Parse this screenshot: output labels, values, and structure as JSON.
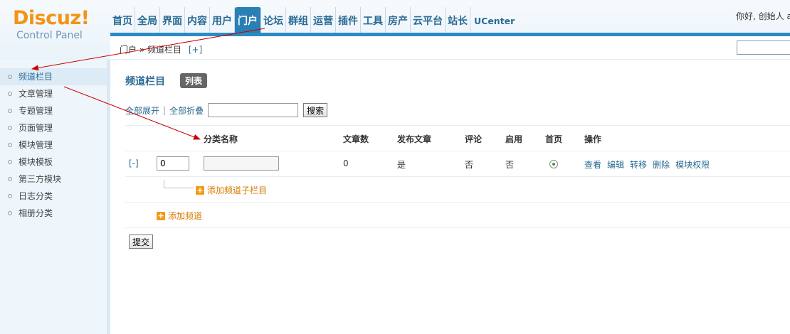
{
  "logo": {
    "word": "Discuz!",
    "subtitle": "Control Panel"
  },
  "topnav": [
    {
      "label": "首页"
    },
    {
      "label": "全局"
    },
    {
      "label": "界面"
    },
    {
      "label": "内容"
    },
    {
      "label": "用户"
    },
    {
      "label": "门户",
      "active": true
    },
    {
      "label": "论坛"
    },
    {
      "label": "群组"
    },
    {
      "label": "运营"
    },
    {
      "label": "插件"
    },
    {
      "label": "工具"
    },
    {
      "label": "房产"
    },
    {
      "label": "云平台"
    },
    {
      "label": "站长"
    },
    {
      "label": "UCenter"
    }
  ],
  "greeting": "你好, 创始人 a",
  "breadcrumb": {
    "path": "门户 » 频道栏目",
    "add": "[+]"
  },
  "sidebar": {
    "items": [
      {
        "label": "频道栏目",
        "active": true
      },
      {
        "label": "文章管理"
      },
      {
        "label": "专题管理"
      },
      {
        "label": "页面管理"
      },
      {
        "label": "模块管理"
      },
      {
        "label": "模块模板"
      },
      {
        "label": "第三方模块"
      },
      {
        "label": "日志分类"
      },
      {
        "label": "相册分类"
      }
    ]
  },
  "main": {
    "title": "频道栏目",
    "tab": "列表",
    "expand_all": "全部展开",
    "separator": "|",
    "collapse_all": "全部折叠",
    "search_button": "搜索",
    "table": {
      "headers": {
        "name": "分类名称",
        "articles": "文章数",
        "publish": "发布文章",
        "comment": "评论",
        "enabled": "启用",
        "homepage": "首页",
        "actions": "操作"
      },
      "row": {
        "collapse": "[-]",
        "order": "0",
        "articles": "0",
        "publish": "是",
        "comment": "否",
        "enabled": "否",
        "actions": [
          "查看",
          "编辑",
          "转移",
          "删除",
          "模块权限"
        ]
      }
    },
    "add_subchannel": "添加频道子栏目",
    "add_channel": "添加频道",
    "submit": "提交"
  },
  "colors": {
    "nav_text": "#2b6a93",
    "nav_active_bg": "#2a7fb5",
    "logo_orange": "#f39414",
    "add_link_orange": "#d67b00",
    "arrow_red": "#cc0000"
  }
}
